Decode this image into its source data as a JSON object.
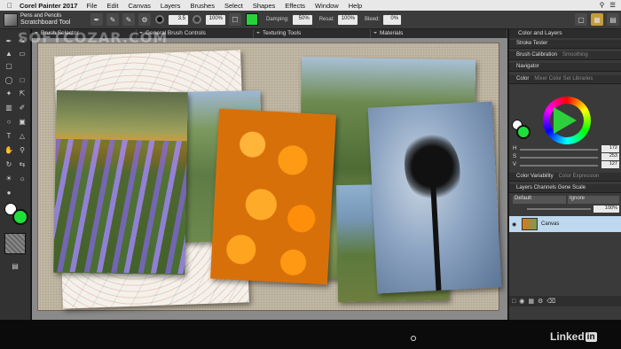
{
  "menubar": {
    "apple": "",
    "app_name": "Corel Painter 2017",
    "items": [
      "File",
      "Edit",
      "Canvas",
      "Layers",
      "Brushes",
      "Select",
      "Shapes",
      "Effects",
      "Window",
      "Help"
    ]
  },
  "propbar": {
    "variant_category": "Pens and Pencils",
    "variant_name": "Scratchboard Tool",
    "size_value": "3.5",
    "opacity_value": "100%",
    "damping_label": "Damping:",
    "damping_value": "50%",
    "resat_label": "Resat:",
    "resat_value": "100%",
    "bleed_label": "Bleed:",
    "bleed_value": "0%",
    "color_swatch": "#26d43a"
  },
  "watermark": "SOFTCOZAR.COM",
  "panel_tabs": [
    "Brush Selector",
    "General Brush Controls",
    "Texturing Tools",
    "Materials"
  ],
  "right_panel": {
    "title": "Color and Layers",
    "rows": [
      {
        "label": "Stroke Tester",
        "sub": ""
      },
      {
        "label": "Brush Calibration",
        "sub": "Smoothing"
      },
      {
        "label": "Navigator",
        "sub": ""
      },
      {
        "label": "Color",
        "sub": "Mixer   Color Set Libraries"
      }
    ],
    "hsv": [
      {
        "label": "H",
        "value": "172"
      },
      {
        "label": "S",
        "value": "253"
      },
      {
        "label": "V",
        "value": "127"
      }
    ],
    "color_variability": "Color Variability",
    "color_expression": "Color Expression",
    "layers_tabs": "Layers   Channels   Gene Scale",
    "blend_mode": "Default",
    "composite": "Ignore",
    "opacity": "100%",
    "layer_name": "Canvas"
  },
  "colors": {
    "foreground": "#1ee03b",
    "background": "#ffffff"
  },
  "footer": {
    "brand": "Linked",
    "brand_in": "in"
  }
}
